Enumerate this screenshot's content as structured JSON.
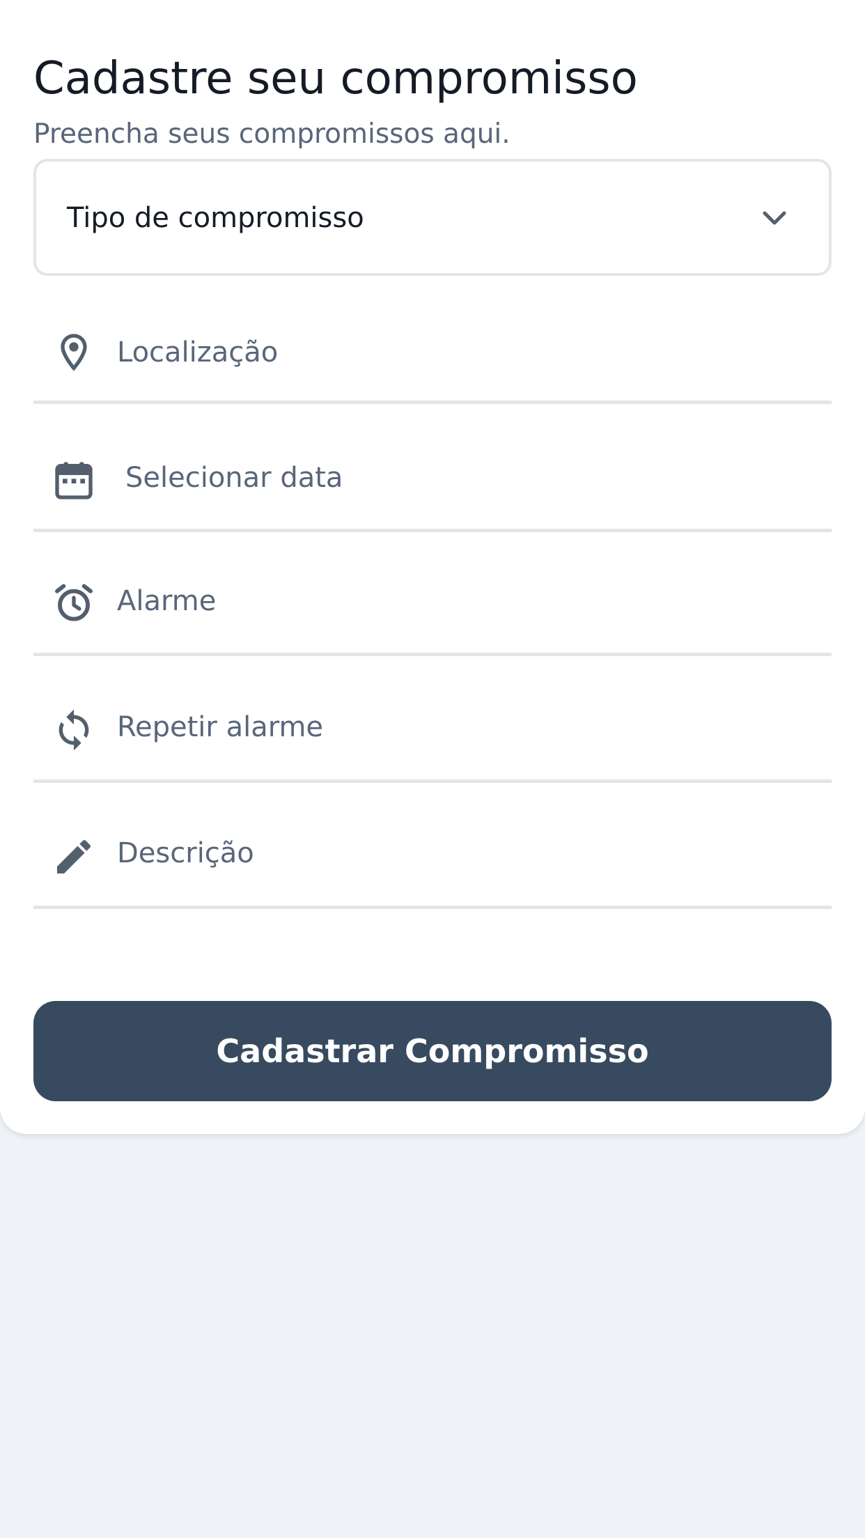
{
  "header": {
    "title": "Cadastre seu compromisso",
    "subtitle": "Preencha seus compromissos aqui."
  },
  "appointment_type": {
    "selected": "Tipo de compromisso"
  },
  "fields": {
    "location": {
      "placeholder": "Localização",
      "icon": "location-pin-icon"
    },
    "date": {
      "placeholder": "Selecionar data",
      "icon": "calendar-icon"
    },
    "alarm": {
      "placeholder": "Alarme",
      "icon": "alarm-clock-icon"
    },
    "repeat_alarm": {
      "placeholder": "Repetir alarme",
      "icon": "repeat-icon"
    },
    "description": {
      "placeholder": "Descrição",
      "icon": "pencil-icon"
    }
  },
  "submit": {
    "label": "Cadastrar Compromisso"
  },
  "colors": {
    "primary_button": "#374a60",
    "icon": "#535f6c",
    "placeholder": "#59667a",
    "divider": "#e2e5ea",
    "background": "#eff2f7"
  }
}
